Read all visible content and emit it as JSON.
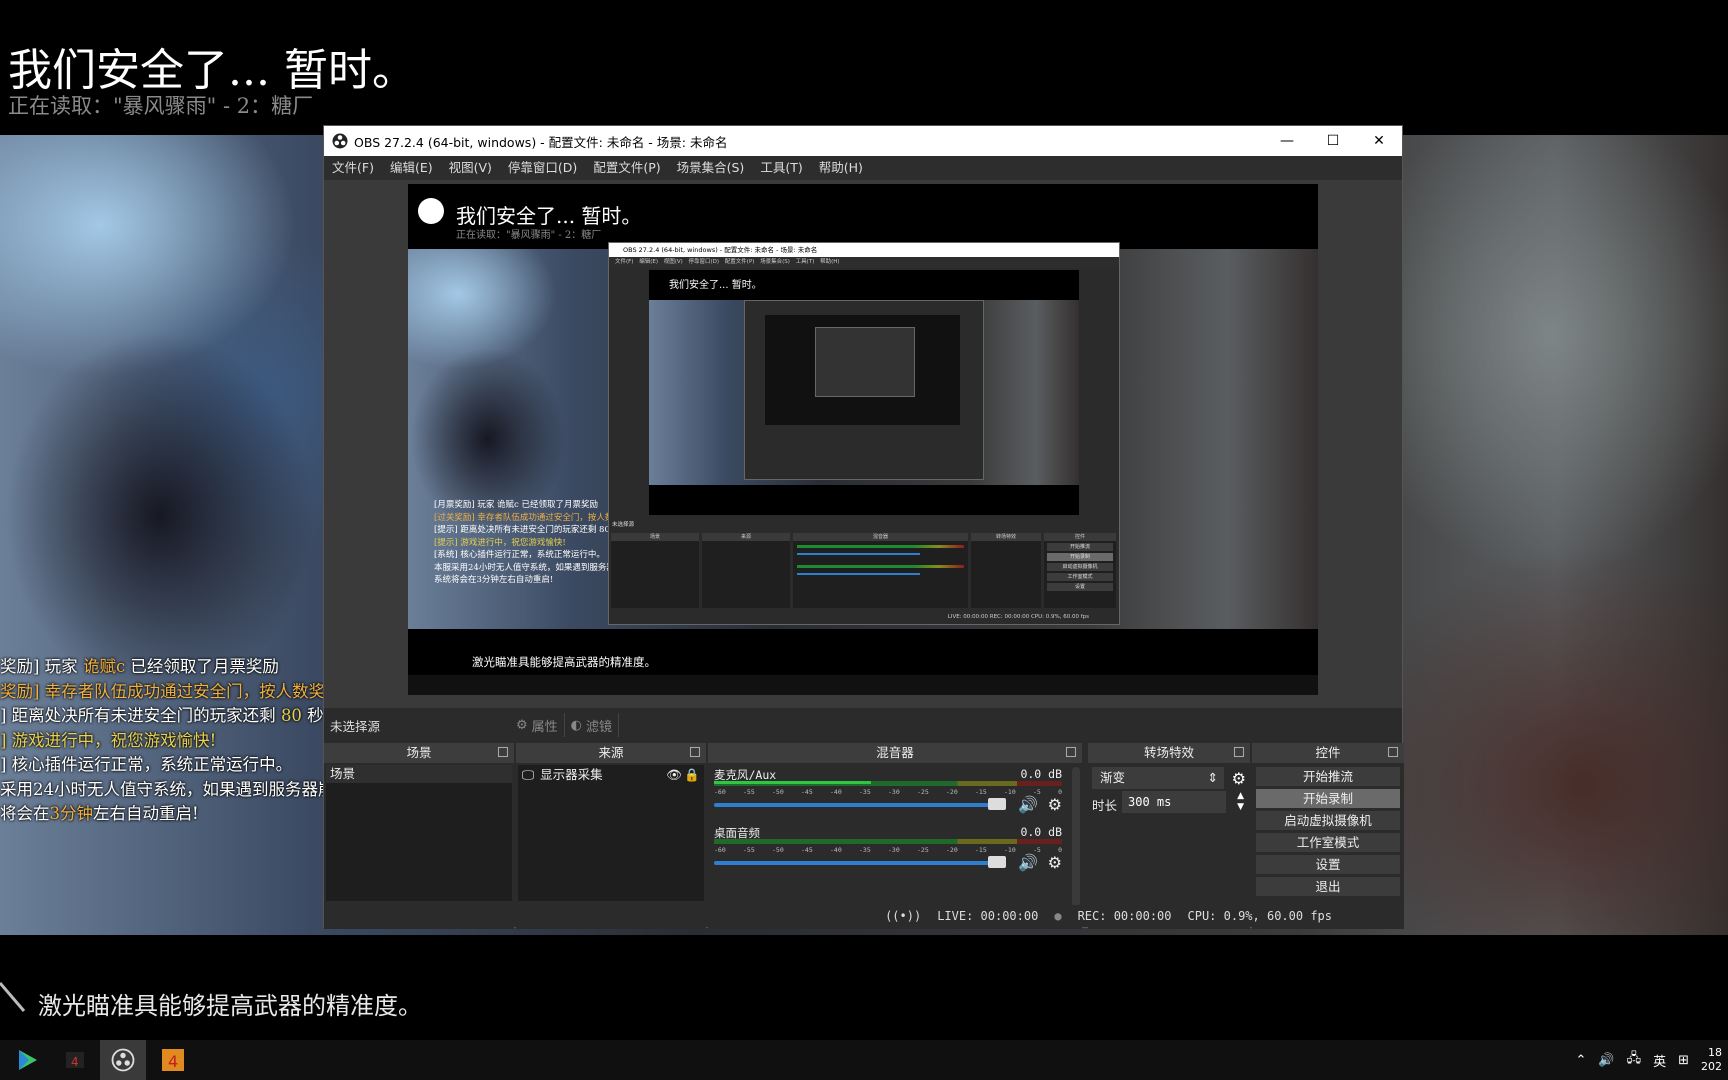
{
  "game": {
    "title": "我们安全了... 暂时。",
    "subtitle": "正在读取：\"暴风骤雨\" - 2：糖厂",
    "hint": "激光瞄准具能够提高武器的精准度。",
    "chat": [
      {
        "pre": "奖励] 玩家 ",
        "hl": "诡赋c",
        "post": " 已经领取了月票奖励"
      },
      {
        "pre": "奖励] 幸存者队伍成功通过安全门，按人数奖",
        "hl": "",
        "post": ""
      },
      {
        "pre": "] 距离处决所有未进安全门的玩家还剩 ",
        "hl": "80",
        "post": " 秒"
      },
      {
        "pre": "] 游戏进行中，祝您游戏愉快!",
        "hl": "",
        "post": ""
      },
      {
        "pre": "] 核心插件运行正常，系统正常运行中。",
        "hl": "",
        "post": ""
      },
      {
        "pre": "采用24小时无人值守系统，如果遇到服务器崩",
        "hl": "",
        "post": ""
      },
      {
        "pre": "将会在",
        "hl": "3分钟",
        "post": "左右自动重启!"
      }
    ]
  },
  "obs": {
    "title": "OBS 27.2.4 (64-bit, windows) - 配置文件: 未命名 - 场景: 未命名",
    "menu": [
      "文件(F)",
      "编辑(E)",
      "视图(V)",
      "停靠窗口(D)",
      "配置文件(P)",
      "场景集合(S)",
      "工具(T)",
      "帮助(H)"
    ],
    "no_source": "未选择源",
    "properties": "属性",
    "filters": "滤镜",
    "docks": {
      "scenes": "场景",
      "sources": "来源",
      "mixer": "混音器",
      "transitions": "转场特效",
      "controls": "控件"
    },
    "scene_item": "场景",
    "source_item": "显示器采集",
    "mixer_tracks": [
      {
        "name": "麦克风/Aux",
        "db": "0.0 dB",
        "level": 0.45
      },
      {
        "name": "桌面音频",
        "db": "0.0 dB",
        "level": 0.0
      }
    ],
    "meter_ticks": [
      "-60",
      "-55",
      "-50",
      "-45",
      "-40",
      "-35",
      "-30",
      "-25",
      "-20",
      "-15",
      "-10",
      "-5",
      "0"
    ],
    "transition": "渐变",
    "duration_label": "时长",
    "duration_value": "300 ms",
    "controls": [
      "开始推流",
      "开始录制",
      "启动虚拟摄像机",
      "工作室模式",
      "设置",
      "退出"
    ],
    "status": {
      "live": "LIVE: 00:00:00",
      "rec": "REC: 00:00:00",
      "cpu": "CPU: 0.9%, 60.00 fps"
    }
  },
  "preview": {
    "title": "我们安全了... 暂时。",
    "subtitle": "正在读取：\"暴风骤雨\" - 2：糖厂",
    "hint": "激光瞄准具能够提高武器的精准度。",
    "obs_title": "OBS 27.2.4 (64-bit, windows) - 配置文件: 未命名 - 场景: 未命名",
    "obs_menu": "文件(F) 编辑(E) 视图(V) 停靠窗口(D) 配置文件(P) 场景集合(S) 工具(T) 帮助(H)",
    "no_source": "未选择源",
    "status": "LIVE: 00:00:00   REC: 00:00:00   CPU: 0.9%, 60.00 fps",
    "chat": [
      "[月票奖励] 玩家 诡赋c 已经领取了月票奖励",
      "[过关奖励] 幸存者队伍成功通过安全门，按人数奖",
      "[提示] 距离处决所有未进安全门的玩家还剩 80 秒",
      "[提示] 游戏进行中，祝您游戏愉快!",
      "[系统] 核心插件运行正常，系统正常运行中。",
      "本服采用24小时无人值守系统，如果遇到服务器崩",
      "系统将会在3分钟左右自动重启!"
    ]
  },
  "taskbar": {
    "ime": "英",
    "clock_time": "18",
    "clock_date": "202"
  }
}
